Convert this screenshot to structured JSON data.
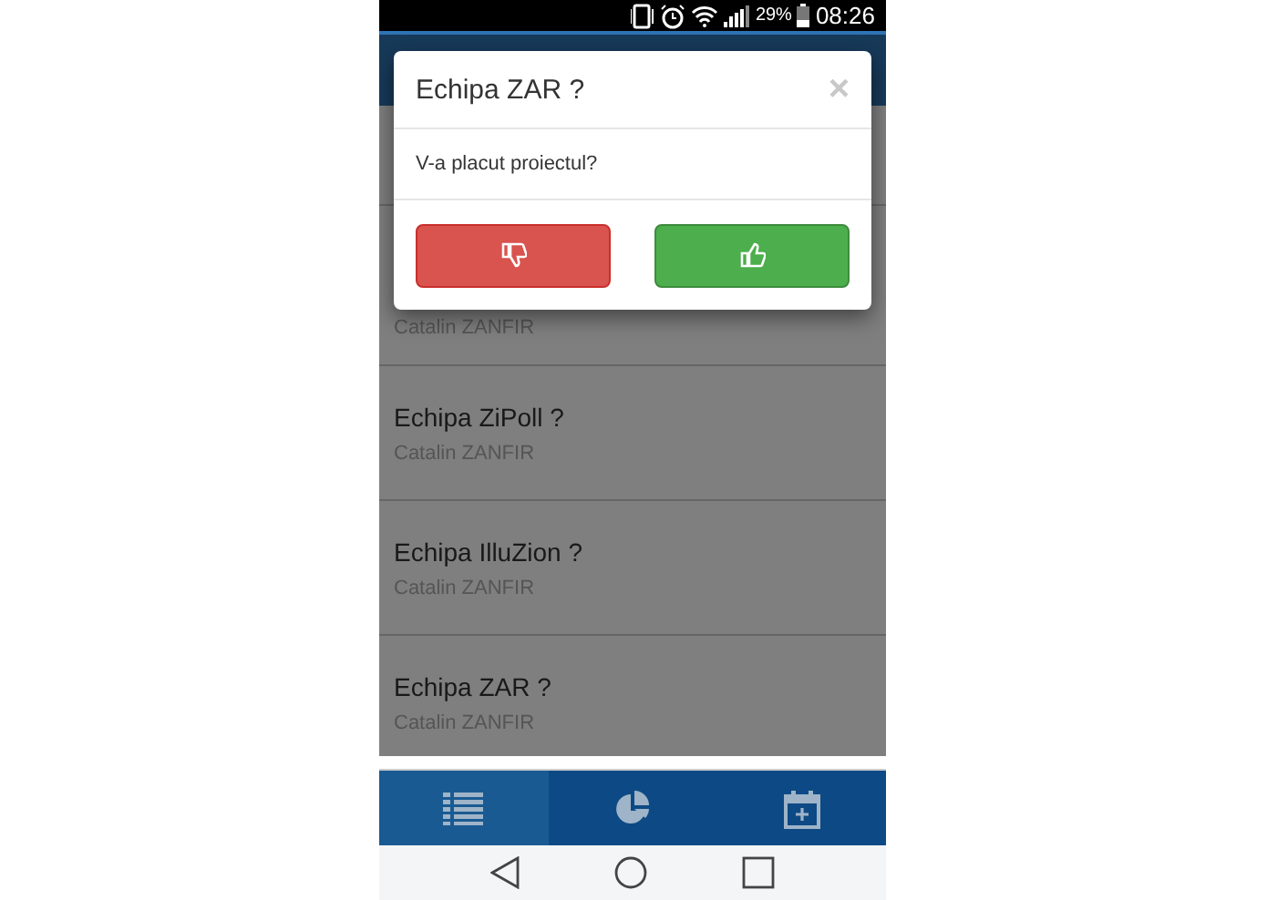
{
  "status_bar": {
    "battery": "29%",
    "time": "08:26"
  },
  "list": [
    {
      "subtitle": "Catalin ZANFIR"
    },
    {
      "title": "Echipa ZiPoll ?",
      "subtitle": "Catalin ZANFIR"
    },
    {
      "title": "Echipa IlluZion ?",
      "subtitle": "Catalin ZANFIR"
    },
    {
      "title": "Echipa ZAR ?",
      "subtitle": "Catalin ZANFIR"
    }
  ],
  "dialog": {
    "title": "Echipa ZAR ?",
    "close": "×",
    "message": "V-a placut proiectul?",
    "buttons": [
      {
        "kind": "dislike"
      },
      {
        "kind": "like"
      }
    ]
  },
  "tabs": [
    {
      "kind": "list",
      "selected": true
    },
    {
      "kind": "chart",
      "selected": false
    },
    {
      "kind": "calendar",
      "selected": false
    }
  ]
}
